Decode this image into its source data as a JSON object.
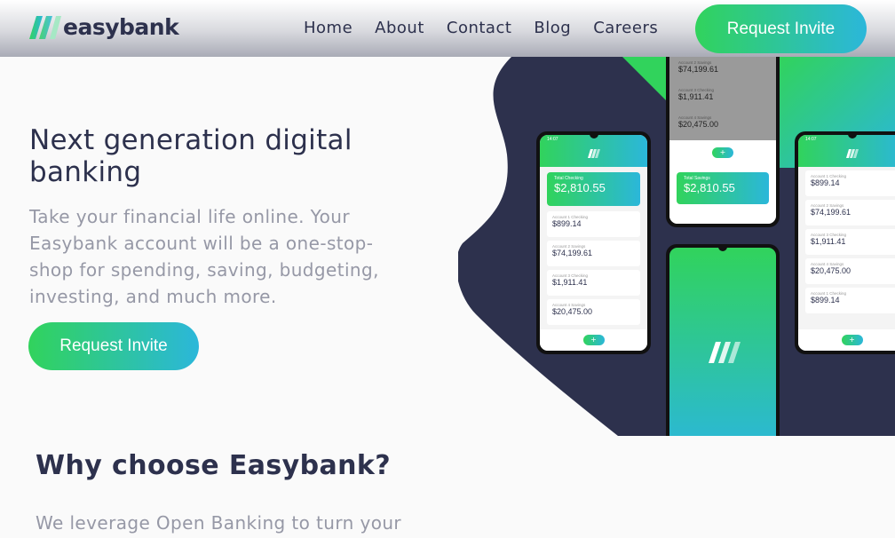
{
  "brand": {
    "name": "easybank"
  },
  "nav": {
    "items": [
      "Home",
      "About",
      "Contact",
      "Blog",
      "Careers"
    ],
    "cta": "Request Invite"
  },
  "hero": {
    "title": "Next generation digital banking",
    "text": "Take your financial life online. Your Easybank account will be a one-stop-shop for spending, saving, budgeting, investing, and much more.",
    "cta": "Request Invite"
  },
  "why": {
    "title": "Why choose Easybank?",
    "text": "We leverage Open Banking to turn your"
  },
  "mockup": {
    "total_label": "Total Checking",
    "total_value": "$2,810.55",
    "accounts": [
      {
        "label": "Account 1 Checking",
        "value": "$899.14"
      },
      {
        "label": "Account 2 Savings",
        "value": "$74,199.61"
      },
      {
        "label": "Account 3 Checking",
        "value": "$1,911.41"
      },
      {
        "label": "Account 4 Savings",
        "value": "$20,475.00"
      }
    ],
    "top_accounts": [
      "$74,199.61",
      "$1,911.41",
      "$20,475.00"
    ]
  },
  "colors": {
    "primary": "#2d314d",
    "accent_green": "#31d35c",
    "accent_cyan": "#2bb7da",
    "muted": "#9698a6"
  }
}
